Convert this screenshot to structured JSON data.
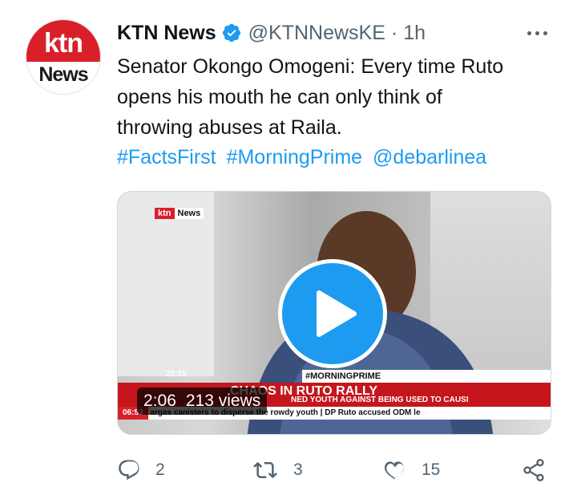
{
  "author": {
    "avatar_logo_top": "ktn",
    "avatar_logo_bottom": "News",
    "name": "KTN News",
    "handle": "@KTNNewsKE",
    "separator": "·",
    "time": "1h"
  },
  "tweet": {
    "lines": [
      "Senator Okongo Omogeni: Every time Ruto",
      "opens his mouth he can  only think of",
      "throwing abuses at Raila."
    ],
    "tags": [
      "#FactsFirst",
      "#MorningPrime",
      "@debarlinea"
    ]
  },
  "media": {
    "duration": "2:06",
    "views": "213 views",
    "logo_left": "ktn",
    "logo_right": "News",
    "ticker_top": "#MORNINGPRIME",
    "ticker_headline": "CHAOS IN RUTO RALLY",
    "ticker_sub": "NED YOUTH AGAINST BEING USED TO CAUSI",
    "ticker_clock_top": "22:15",
    "ticker_clock": "06:53",
    "ticker_bottom": "argas canisters to disperse the rowdy youth  |  DP Ruto accused ODM le"
  },
  "actions": {
    "reply_count": "2",
    "retweet_count": "3",
    "like_count": "15"
  },
  "colors": {
    "accent": "#1d9bf0",
    "text": "#0f1419",
    "muted": "#536471",
    "ktn_red": "#d9202a"
  },
  "icons": [
    "verified-badge-icon",
    "more-icon",
    "play-icon",
    "reply-icon",
    "retweet-icon",
    "like-icon",
    "share-icon"
  ]
}
